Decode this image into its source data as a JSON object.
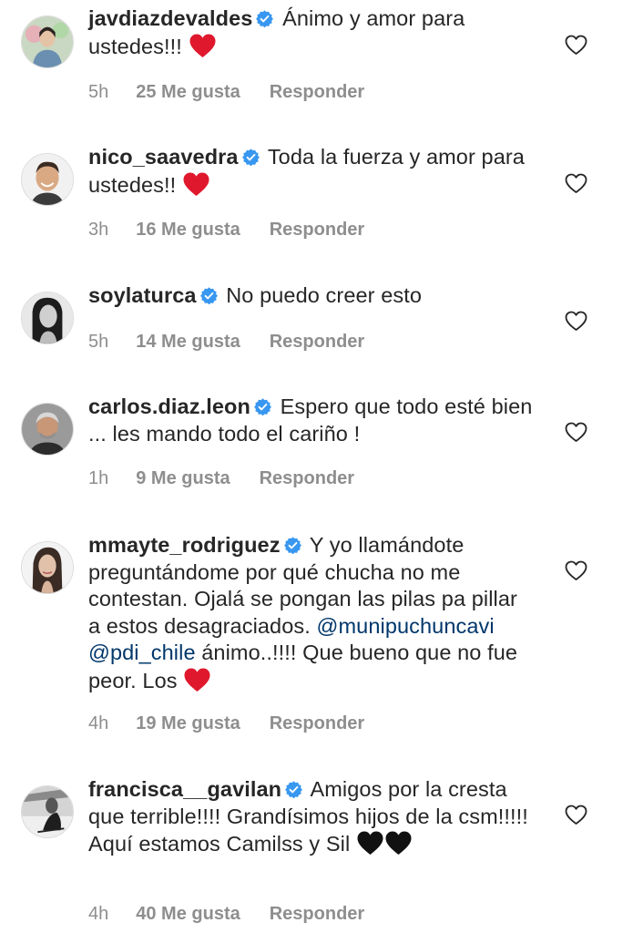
{
  "comments": [
    {
      "username": "javdiazdevaldes",
      "text": "Ánimo y amor para ustedes!!!",
      "mentions": [],
      "text_after": "",
      "emoji": [
        "red-heart"
      ],
      "time": "5h",
      "likes": "25 Me gusta",
      "reply": "Responder"
    },
    {
      "username": "nico_saavedra",
      "text": "Toda la fuerza y amor para ustedes!!",
      "mentions": [],
      "text_after": "",
      "emoji": [
        "red-heart"
      ],
      "time": "3h",
      "likes": "16 Me gusta",
      "reply": "Responder"
    },
    {
      "username": "soylaturca",
      "text": "No puedo creer esto",
      "mentions": [],
      "text_after": "",
      "emoji": [],
      "time": "5h",
      "likes": "14 Me gusta",
      "reply": "Responder"
    },
    {
      "username": "carlos.diaz.leon",
      "text": "Espero que todo esté bien ... les mando todo el cariño !",
      "mentions": [],
      "text_after": "",
      "emoji": [],
      "time": "1h",
      "likes": "9 Me gusta",
      "reply": "Responder"
    },
    {
      "username": "mmayte_rodriguez",
      "text": "Y yo llamándote preguntándome por qué chucha no me contestan. Ojalá se pongan las pilas pa pillar a estos desagraciados.",
      "mentions": [
        "@munipuchuncavi",
        "@pdi_chile"
      ],
      "text_after": "ánimo..!!!! Que bueno que no fue peor. Los",
      "emoji": [
        "red-heart"
      ],
      "time": "4h",
      "likes": "19 Me gusta",
      "reply": "Responder"
    },
    {
      "username": "francisca__gavilan",
      "text": "Amigos  por la cresta que terrible!!!! Grandísimos hijos de la csm!!!!! Aquí estamos Camilss y Sil",
      "mentions": [],
      "text_after": "",
      "emoji": [
        "black-heart",
        "black-heart"
      ],
      "time": "4h",
      "likes": "40 Me gusta",
      "reply": "Responder"
    }
  ],
  "colors": {
    "text": "#262626",
    "secondary": "#8e8e8e",
    "verified": "#3897f0",
    "mention": "#00376b",
    "red_heart": "#e0182d",
    "black_heart": "#111111"
  }
}
